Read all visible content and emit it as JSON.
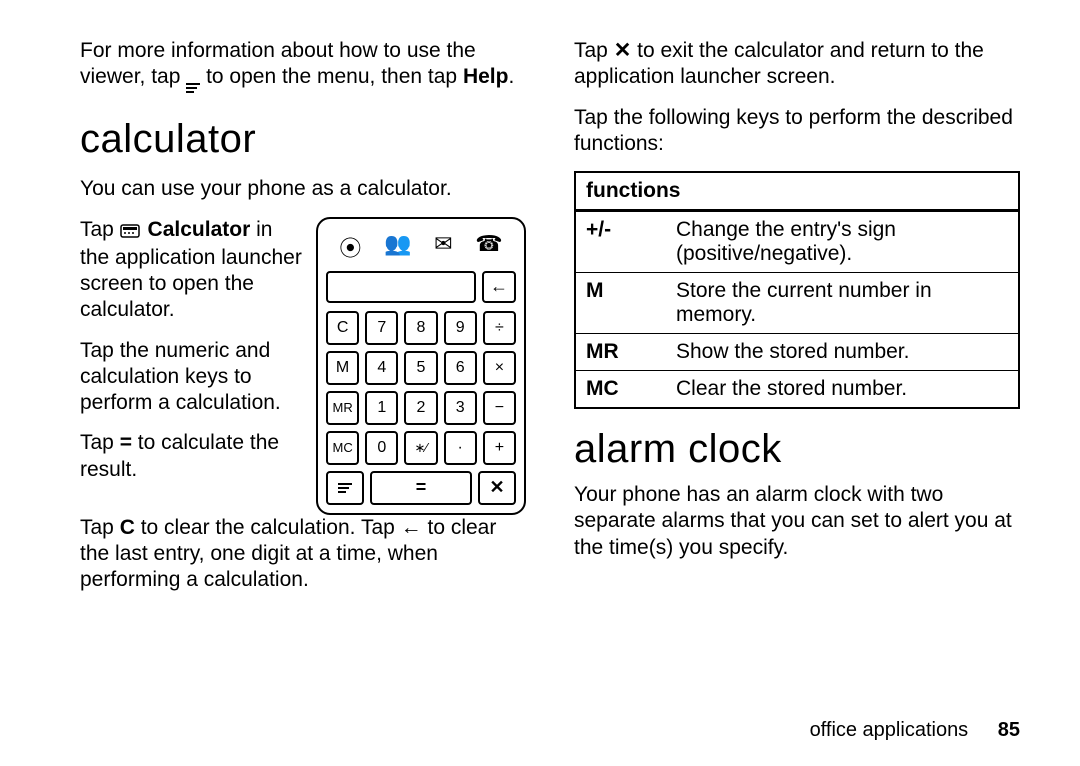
{
  "left": {
    "intro_a": "For more information about how to use the viewer, tap ",
    "intro_b": " to open the menu, then tap ",
    "help": "Help",
    "period": ".",
    "h1": "calculator",
    "p1": "You can use your phone as a calculator.",
    "p2a": "Tap ",
    "p2app": "Calculator",
    "p2b": " in the application launcher screen to open the calculator.",
    "p3": "Tap the numeric and calculation keys to perform a calculation.",
    "p4a": "Tap ",
    "p4eq": "=",
    "p4b": " to calculate the result.",
    "p5a": "Tap ",
    "p5c": "C",
    "p5b": " to clear the calculation. Tap ",
    "p5d": " to clear the last entry, one digit at a time, when performing a calculation."
  },
  "calc": {
    "keys": [
      "C",
      "7",
      "8",
      "9",
      "÷",
      "M",
      "4",
      "5",
      "6",
      "×",
      "MR",
      "1",
      "2",
      "3",
      "−",
      "MC",
      "0",
      "∗⁄",
      "·",
      "+"
    ],
    "back": "←",
    "menu": "≡",
    "eq": "=",
    "close": "✕",
    "topicons": [
      "⦿",
      "👥",
      "✉",
      "☎"
    ]
  },
  "right": {
    "p1a": "Tap ",
    "p1x": "✕",
    "p1b": " to exit the calculator and return to the application launcher screen.",
    "p2": "Tap the following keys to perform the described functions:",
    "tableHeader": "functions",
    "rows": [
      {
        "k": "+/-",
        "v": "Change the entry's sign (positive/negative)."
      },
      {
        "k": "M",
        "v": "Store the current number in memory."
      },
      {
        "k": "MR",
        "v": "Show the stored number."
      },
      {
        "k": "MC",
        "v": "Clear the stored number."
      }
    ],
    "h2": "alarm clock",
    "p3": "Your phone has an alarm clock with two separate alarms that you can set to alert you at the time(s) you specify."
  },
  "footer": {
    "section": "office applications",
    "page": "85"
  }
}
